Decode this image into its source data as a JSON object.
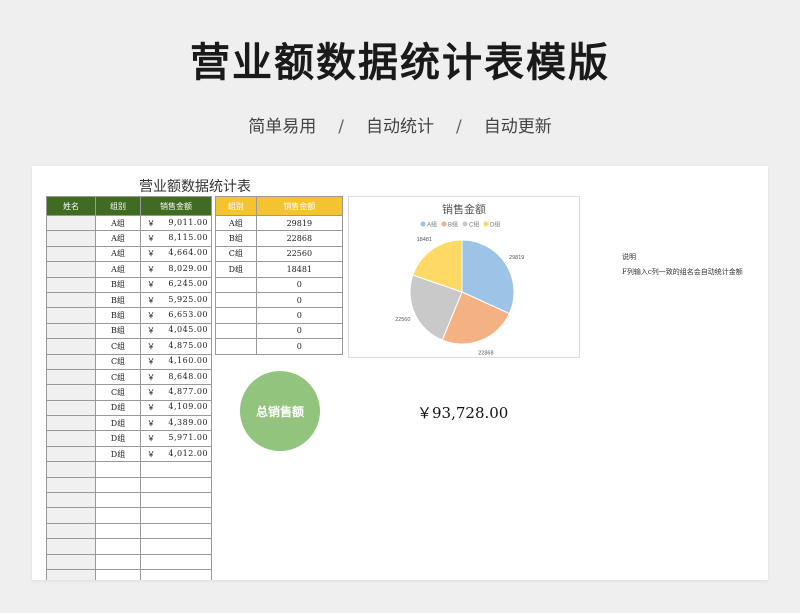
{
  "header": {
    "title": "营业额数据统计表模版",
    "features": [
      "简单易用",
      "自动统计",
      "自动更新"
    ],
    "separator": "/"
  },
  "sheet": {
    "title": "营业额数据统计表",
    "detail_table": {
      "headers": [
        "姓名",
        "组别",
        "销售金额"
      ],
      "currency_symbol": "￥",
      "rows": [
        {
          "name": "",
          "group": "A组",
          "amount": "9,011.00"
        },
        {
          "name": "",
          "group": "A组",
          "amount": "8,115.00"
        },
        {
          "name": "",
          "group": "A组",
          "amount": "4,664.00"
        },
        {
          "name": "",
          "group": "A组",
          "amount": "8,029.00"
        },
        {
          "name": "",
          "group": "B组",
          "amount": "6,245.00"
        },
        {
          "name": "",
          "group": "B组",
          "amount": "5,925.00"
        },
        {
          "name": "",
          "group": "B组",
          "amount": "6,653.00"
        },
        {
          "name": "",
          "group": "B组",
          "amount": "4,045.00"
        },
        {
          "name": "",
          "group": "C组",
          "amount": "4,875.00"
        },
        {
          "name": "",
          "group": "C组",
          "amount": "4,160.00"
        },
        {
          "name": "",
          "group": "C组",
          "amount": "8,648.00"
        },
        {
          "name": "",
          "group": "C组",
          "amount": "4,877.00"
        },
        {
          "name": "",
          "group": "D组",
          "amount": "4,109.00"
        },
        {
          "name": "",
          "group": "D组",
          "amount": "4,389.00"
        },
        {
          "name": "",
          "group": "D组",
          "amount": "5,971.00"
        },
        {
          "name": "",
          "group": "D组",
          "amount": "4,012.00"
        }
      ],
      "empty_rows": 8
    },
    "summary_table": {
      "headers": [
        "组别",
        "销售金额"
      ],
      "rows": [
        {
          "group": "A组",
          "value": "29819"
        },
        {
          "group": "B组",
          "value": "22868"
        },
        {
          "group": "C组",
          "value": "22560"
        },
        {
          "group": "D组",
          "value": "18481"
        },
        {
          "group": "",
          "value": "0"
        },
        {
          "group": "",
          "value": "0"
        },
        {
          "group": "",
          "value": "0"
        },
        {
          "group": "",
          "value": "0"
        },
        {
          "group": "",
          "value": "0"
        }
      ]
    },
    "total_label": "总销售额",
    "total_value": "￥93,728.00",
    "note_title": "说明",
    "note_text": "F列输入c列一致的组名会自动统计金额"
  },
  "chart_data": {
    "type": "pie",
    "title": "销售金额",
    "categories": [
      "A组",
      "B组",
      "C组",
      "D组"
    ],
    "values": [
      29819,
      22868,
      22560,
      18481
    ],
    "data_labels": [
      "29819",
      "22868",
      "22560",
      "18481"
    ],
    "colors": [
      "#9dc3e6",
      "#f4b183",
      "#c9c9c9",
      "#ffd966"
    ],
    "legend_position": "top"
  },
  "colors": {
    "detail_header": "#3f6b22",
    "summary_header": "#f4c430",
    "total_circle": "#93c47d"
  }
}
